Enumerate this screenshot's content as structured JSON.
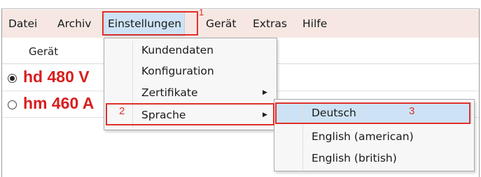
{
  "menubar": {
    "items": [
      "Datei",
      "Archiv",
      "Einstellungen",
      "Gerät",
      "Extras",
      "Hilfe"
    ]
  },
  "list": {
    "column_header": "Gerät",
    "rows": [
      {
        "name": "hd 480 V",
        "selected": true
      },
      {
        "name": "hm 460 A",
        "selected": false
      }
    ]
  },
  "dropdown": {
    "items": [
      "Kundendaten",
      "Konfiguration",
      "Zertifikate",
      "Sprache"
    ],
    "submenu_arrow_icon": "triangle-right-icon"
  },
  "submenu": {
    "items": [
      "Deutsch",
      "English (american)",
      "English (british)"
    ],
    "selected": "Deutsch"
  },
  "annotations": {
    "step1": "1",
    "step2": "2",
    "step3": "3",
    "color": "#e0302a"
  },
  "colors": {
    "menubar_bg": "#f6e7e3",
    "highlight_bg": "#cde3f5",
    "device_name": "#d81e1e"
  }
}
